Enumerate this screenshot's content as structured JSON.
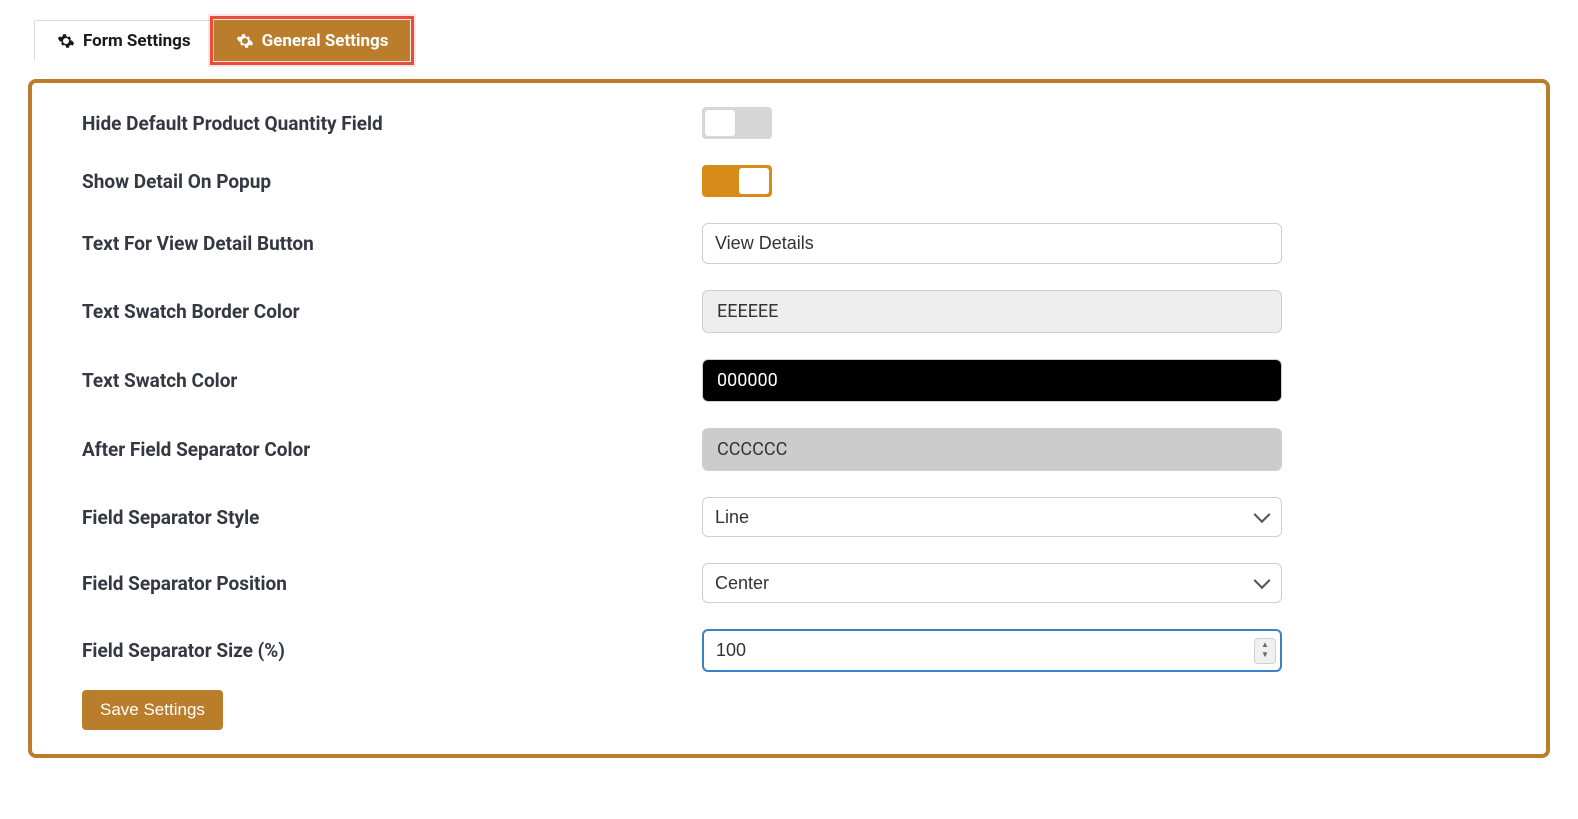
{
  "tabs": {
    "form_settings": "Form Settings",
    "general_settings": "General Settings"
  },
  "settings": {
    "hide_qty": {
      "label": "Hide Default Product Quantity Field",
      "value": false
    },
    "show_popup": {
      "label": "Show Detail On Popup",
      "value": true
    },
    "view_detail_text": {
      "label": "Text For View Detail Button",
      "value": "View Details"
    },
    "swatch_border_color": {
      "label": "Text Swatch Border Color",
      "value": "EEEEEE"
    },
    "swatch_color": {
      "label": "Text Swatch Color",
      "value": "000000"
    },
    "separator_color": {
      "label": "After Field Separator Color",
      "value": "CCCCCC"
    },
    "separator_style": {
      "label": "Field Separator Style",
      "value": "Line"
    },
    "separator_position": {
      "label": "Field Separator Position",
      "value": "Center"
    },
    "separator_size": {
      "label": "Field Separator Size (%)",
      "value": "100"
    }
  },
  "buttons": {
    "save": "Save Settings"
  },
  "colors": {
    "accent": "#b97d2b",
    "highlight": "#e74c3c"
  }
}
